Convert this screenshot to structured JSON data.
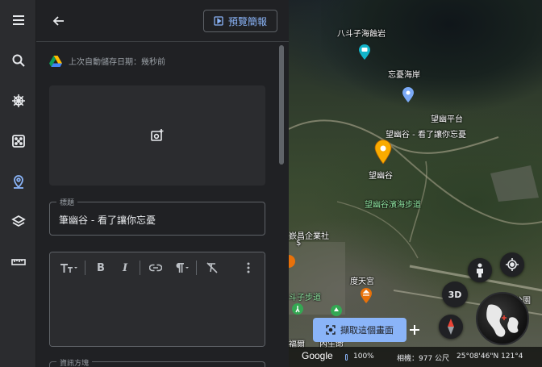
{
  "rail": {
    "items": [
      {
        "name": "menu",
        "icon": "menu-icon"
      },
      {
        "name": "search",
        "icon": "search-icon"
      },
      {
        "name": "voyager",
        "icon": "ship-wheel-icon"
      },
      {
        "name": "feeling-lucky",
        "icon": "dice-icon"
      },
      {
        "name": "projects",
        "icon": "map-pin-icon",
        "active": true
      },
      {
        "name": "map-style",
        "icon": "layers-icon"
      },
      {
        "name": "measure",
        "icon": "ruler-icon"
      }
    ]
  },
  "panel": {
    "preview_label": "預覽簡報",
    "save_status": "上次自動儲存日期：幾秒前",
    "title_field": {
      "label": "標題",
      "value": "筆幽谷 - 看了讓你忘憂"
    },
    "info_field": {
      "label": "資訊方塊"
    },
    "toolbar": {
      "bold": "B",
      "italic": "I"
    }
  },
  "map": {
    "labels": {
      "place1": "八斗子海蝕岩",
      "place2": "忘憂海岸",
      "place3": "望幽平台",
      "place4": "望幽谷 - 看了讓你忘憂",
      "place5": "望幽谷",
      "trail": "望幽谷濱海步道",
      "company": "嶔昌企業社",
      "company_sub": "$",
      "temple": "度天宮",
      "trail2": "斗子步道",
      "bottom_left": "福爾",
      "bottom_mid": "內生命"
    },
    "view_3d": "3D",
    "capture_label": "擷取這個畫面",
    "corner_text": "公園",
    "footer": {
      "brand": "Google",
      "zoom": "100%",
      "camera": "相機：977 公尺",
      "coords": "25°08'46\"N 121°4"
    }
  },
  "colors": {
    "accent": "#8ab4f8",
    "marker": "#f9ab00",
    "panel_bg": "#202124"
  }
}
